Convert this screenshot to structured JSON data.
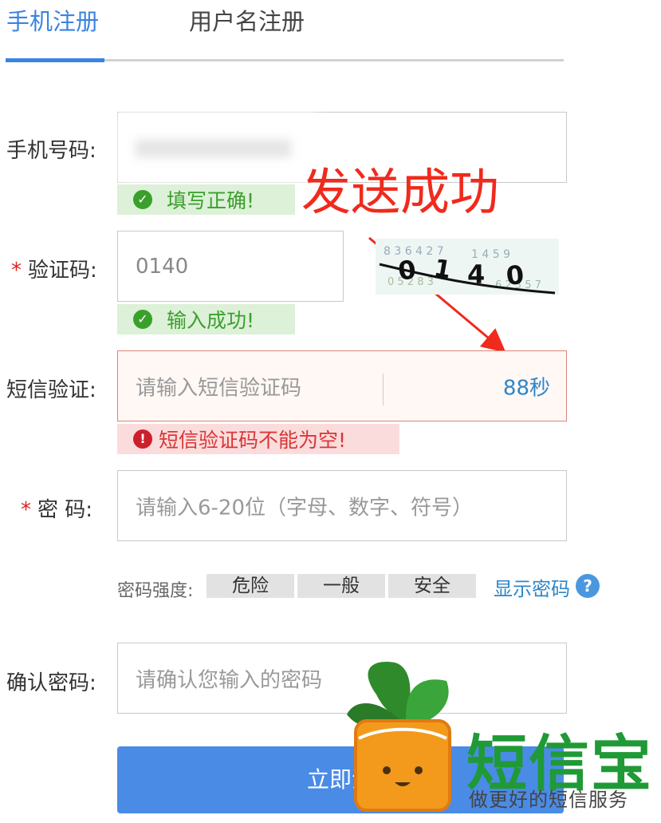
{
  "tabs": [
    {
      "label": "手机注册",
      "active": true
    },
    {
      "label": "用户名注册",
      "active": false
    }
  ],
  "fields": {
    "phone": {
      "label": "手机号码:",
      "status_text": "填写正确!"
    },
    "captcha": {
      "required_mark": "*",
      "label": "验证码:",
      "value": "0140",
      "status_text": "输入成功!"
    },
    "sms": {
      "label": "短信验证:",
      "placeholder": "请输入短信验证码",
      "countdown": "88秒",
      "error_text": "短信验证码不能为空!"
    },
    "password": {
      "required_mark": "*",
      "label": "密 码:",
      "placeholder": "请输入6-20位（字母、数字、符号）"
    },
    "confirm": {
      "label": "确认密码:",
      "placeholder": "请确认您输入的密码"
    }
  },
  "strength": {
    "label": "密码强度:",
    "levels": [
      "危险",
      "一般",
      "安全"
    ],
    "show_password": "显示密码",
    "help_icon": "question-icon"
  },
  "submit_label": "立即注",
  "annotation": "发送成功",
  "watermark": {
    "title": "短信宝",
    "subtitle": "做更好的短信服务"
  },
  "colors": {
    "accent": "#3b84e0",
    "success": "#3aa02c",
    "error": "#d93636",
    "annotation": "#f02a1d",
    "brand": "#1f9a36"
  }
}
